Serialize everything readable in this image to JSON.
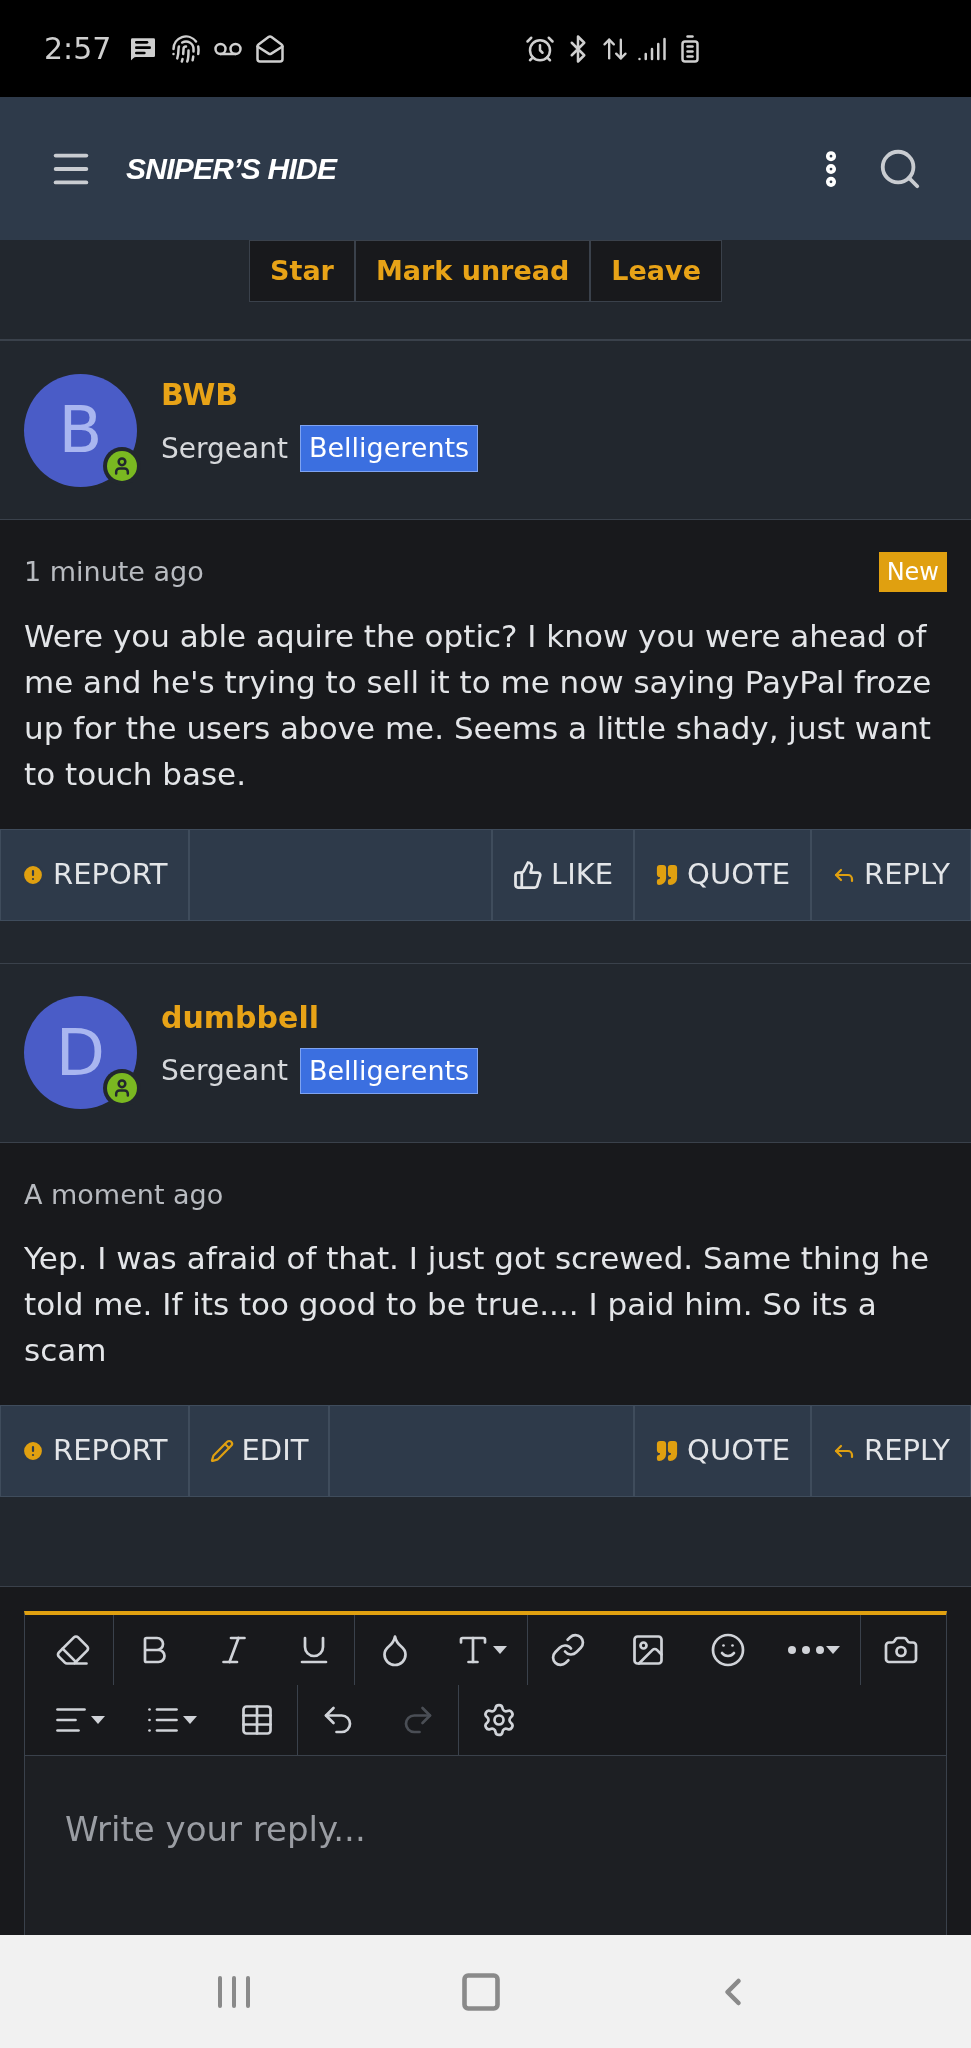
{
  "status_bar": {
    "time": "2:57"
  },
  "header": {
    "logo": "SNIPER’S HIDE"
  },
  "conversation_actions": [
    {
      "label": "Star"
    },
    {
      "label": "Mark unread"
    },
    {
      "label": "Leave"
    }
  ],
  "posts": [
    {
      "avatar": "B",
      "username": "BWB",
      "rank": "Sergeant",
      "group": "Belligerents",
      "online": true,
      "time": "1 minute ago",
      "badge": "New",
      "body": "Were you able aquire the optic? I know you were ahead of me and he's trying to sell it to me now saying PayPal froze up for the users above me. Seems a little shady, just want to touch base.",
      "left_actions": [
        {
          "kind": "report",
          "label": "REPORT"
        }
      ],
      "right_actions": [
        {
          "kind": "like",
          "label": "LIKE"
        },
        {
          "kind": "quote",
          "label": "QUOTE"
        },
        {
          "kind": "reply",
          "label": "REPLY"
        }
      ]
    },
    {
      "avatar": "D",
      "username": "dumbbell",
      "rank": "Sergeant",
      "group": "Belligerents",
      "online": true,
      "time": "A moment ago",
      "body": "Yep. I was afraid of that. I just got screwed. Same thing he told me. If its too good to be true.... I paid him. So its a scam",
      "left_actions": [
        {
          "kind": "report",
          "label": "REPORT"
        },
        {
          "kind": "edit",
          "label": "EDIT"
        }
      ],
      "right_actions": [
        {
          "kind": "quote",
          "label": "QUOTE"
        },
        {
          "kind": "reply",
          "label": "REPLY"
        }
      ]
    }
  ],
  "editor": {
    "placeholder": "Write your reply...",
    "toolbar": [
      [
        [
          {
            "kind": "eraser",
            "disabled": false
          }
        ],
        [
          {
            "kind": "bold",
            "disabled": false
          },
          {
            "kind": "italic",
            "disabled": false
          },
          {
            "kind": "underline",
            "disabled": false
          }
        ],
        [
          {
            "kind": "color",
            "disabled": false
          },
          {
            "kind": "text-size",
            "disabled": false
          }
        ],
        [
          {
            "kind": "link",
            "disabled": false
          },
          {
            "kind": "image",
            "disabled": false
          },
          {
            "kind": "smilie",
            "disabled": false
          },
          {
            "kind": "more",
            "disabled": false
          }
        ],
        [
          {
            "kind": "camera",
            "disabled": false
          }
        ]
      ],
      [
        [
          {
            "kind": "align",
            "disabled": false
          },
          {
            "kind": "list",
            "disabled": false
          },
          {
            "kind": "table",
            "disabled": false
          }
        ],
        [
          {
            "kind": "undo",
            "disabled": false
          },
          {
            "kind": "redo",
            "disabled": true
          }
        ],
        [
          {
            "kind": "settings",
            "disabled": false
          }
        ]
      ]
    ]
  }
}
